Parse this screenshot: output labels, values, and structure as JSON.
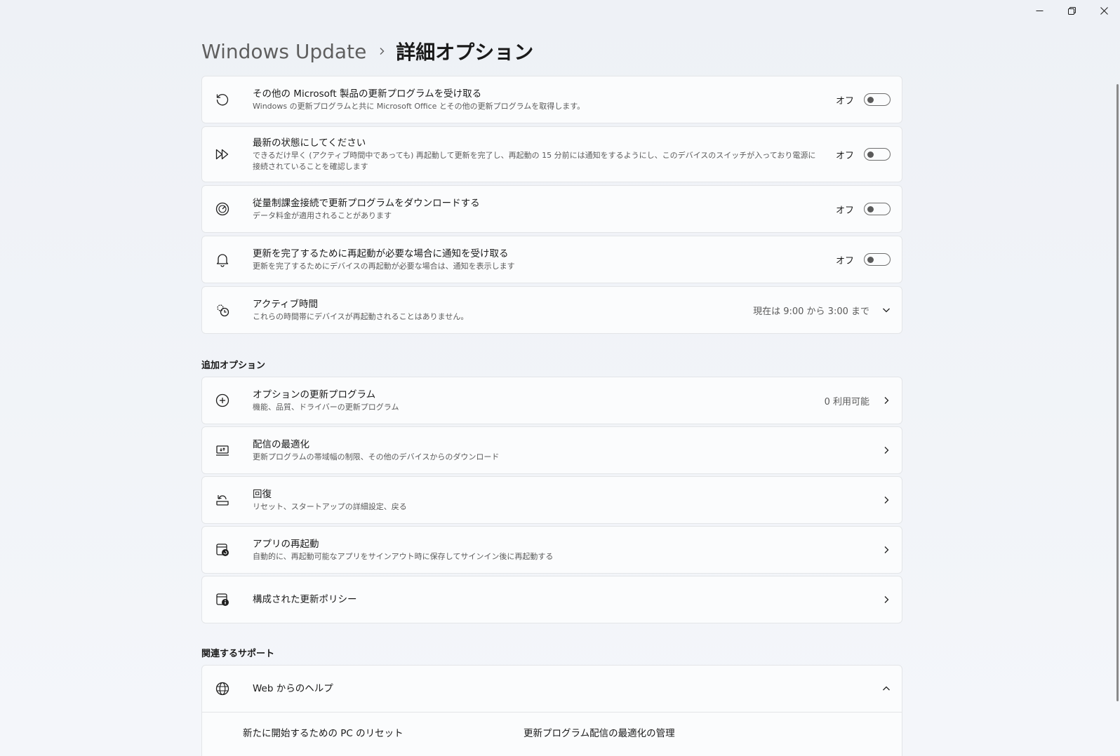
{
  "window": {
    "minimize_icon": "minimize-icon",
    "maximize_icon": "restore-icon",
    "close_icon": "close-icon"
  },
  "header": {
    "parent": "Windows Update",
    "current": "詳細オプション"
  },
  "settings": [
    {
      "icon": "refresh-icon",
      "title": "その他の Microsoft 製品の更新プログラムを受け取る",
      "desc": "Windows の更新プログラムと共に Microsoft Office とその他の更新プログラムを取得します。",
      "state": "オフ",
      "toggled": false
    },
    {
      "icon": "fast-forward-icon",
      "title": "最新の状態にしてください",
      "desc": "できるだけ早く (アクティブ時間中であっても) 再起動して更新を完了し、再起動の 15 分前には通知をするようにし、このデバイスのスイッチが入っており電源に接続されていることを確認します",
      "state": "オフ",
      "toggled": false
    },
    {
      "icon": "speedometer-icon",
      "title": "従量制課金接続で更新プログラムをダウンロードする",
      "desc": "データ料金が適用されることがあります",
      "state": "オフ",
      "toggled": false
    },
    {
      "icon": "bell-icon",
      "title": "更新を完了するために再起動が必要な場合に通知を受け取る",
      "desc": "更新を完了するためにデバイスの再起動が必要な場合は、通知を表示します",
      "state": "オフ",
      "toggled": false
    }
  ],
  "active_hours": {
    "icon": "clock-gear-icon",
    "title": "アクティブ時間",
    "desc": "これらの時間帯にデバイスが再起動されることはありません。",
    "value": "現在は 9:00 から 3:00 まで"
  },
  "additional": {
    "section_title": "追加オプション",
    "items": [
      {
        "icon": "plus-circle-icon",
        "title": "オプションの更新プログラム",
        "desc": "機能、品質、ドライバーの更新プログラム",
        "value": "0 利用可能"
      },
      {
        "icon": "delivery-optimization-icon",
        "title": "配信の最適化",
        "desc": "更新プログラムの帯域幅の制限、その他のデバイスからのダウンロード",
        "value": ""
      },
      {
        "icon": "recovery-icon",
        "title": "回復",
        "desc": "リセット、スタートアップの詳細設定、戻る",
        "value": ""
      },
      {
        "icon": "app-restart-icon",
        "title": "アプリの再起動",
        "desc": "自動的に、再起動可能なアプリをサインアウト時に保存してサインイン後に再起動する",
        "value": ""
      },
      {
        "icon": "policy-info-icon",
        "title": "構成された更新ポリシー",
        "desc": "",
        "value": ""
      }
    ]
  },
  "support": {
    "section_title": "関連するサポート",
    "expander_title": "Web からのヘルプ",
    "expander_icon": "globe-icon",
    "links": [
      "新たに開始するための PC のリセット",
      "更新プログラム配信の最適化の管理"
    ]
  }
}
